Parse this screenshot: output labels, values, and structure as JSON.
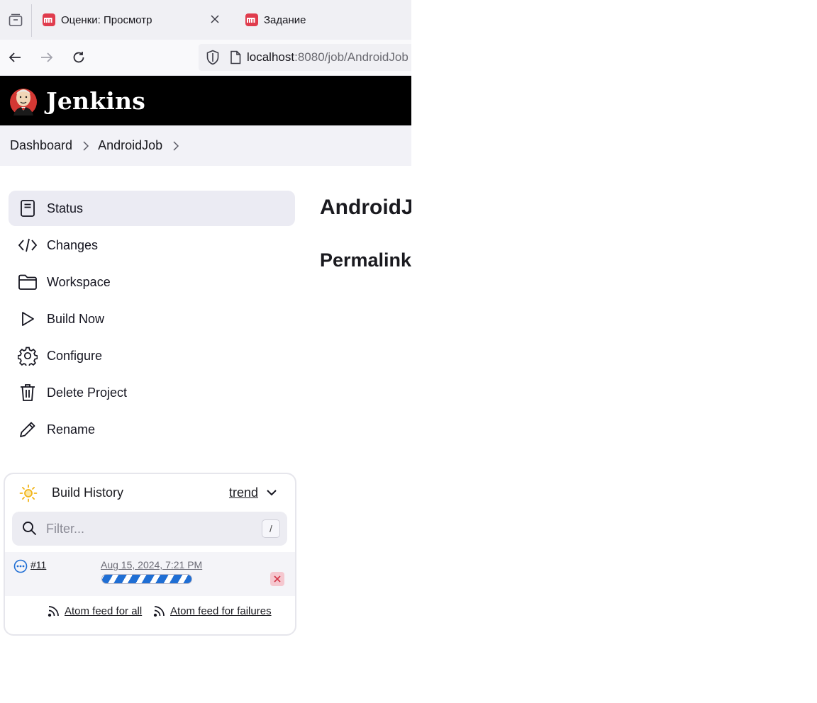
{
  "browser": {
    "tabs": [
      {
        "title": "Оценки: Просмотр",
        "active": true
      },
      {
        "title": "Задание",
        "active": false
      }
    ],
    "url": {
      "host": "localhost",
      "rest": ":8080/job/AndroidJob"
    },
    "icons": [
      "tab-list-icon",
      "back-arrow-icon",
      "forward-arrow-icon",
      "reload-icon",
      "shield-icon",
      "page-icon",
      "close-icon"
    ]
  },
  "header": {
    "title": "Jenkins"
  },
  "breadcrumb": {
    "items": [
      "Dashboard",
      "AndroidJob"
    ]
  },
  "sidebar": {
    "tasks": [
      {
        "label": "Status",
        "icon": "status-icon",
        "selected": true
      },
      {
        "label": "Changes",
        "icon": "code-icon"
      },
      {
        "label": "Workspace",
        "icon": "folder-icon"
      },
      {
        "label": "Build Now",
        "icon": "play-icon"
      },
      {
        "label": "Configure",
        "icon": "gear-icon"
      },
      {
        "label": "Delete Project",
        "icon": "trash-icon"
      },
      {
        "label": "Rename",
        "icon": "pencil-icon"
      }
    ]
  },
  "main": {
    "title": "AndroidJob",
    "permalinks_heading": "Permalinks"
  },
  "build_history": {
    "title": "Build History",
    "trend_label": "trend",
    "filter_placeholder": "Filter...",
    "filter_shortcut": "/",
    "builds": [
      {
        "number": "#11",
        "date": "Aug 15, 2024, 7:21 PM",
        "status": "in-progress"
      }
    ],
    "feeds": {
      "all": "Atom feed for all",
      "failures": "Atom feed for failures"
    }
  },
  "colors": {
    "header_bg": "#000000",
    "accent_blue": "#1f6ed4",
    "favicon_red": "#e03c4d",
    "sun_yellow": "#f2b418",
    "cancel_red": "#d3384a"
  }
}
